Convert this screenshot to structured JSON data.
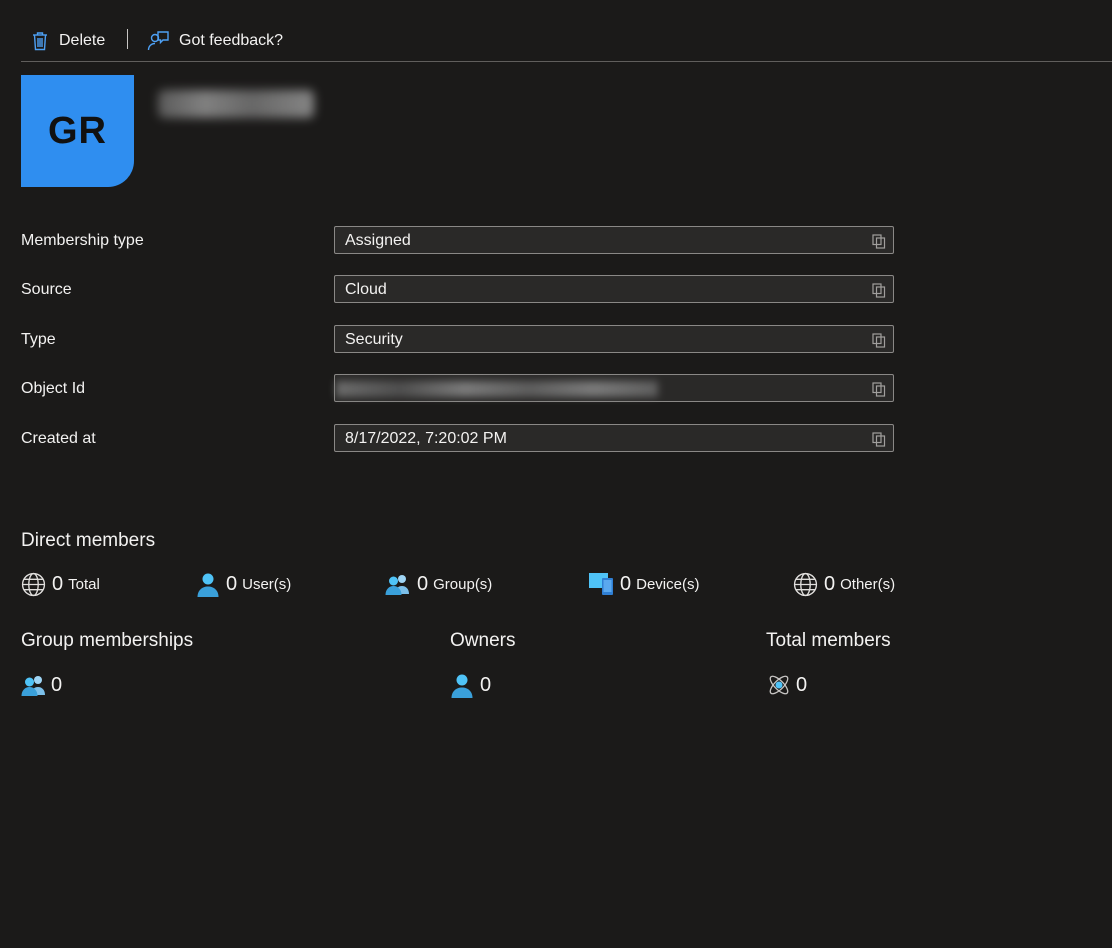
{
  "toolbar": {
    "delete_label": "Delete",
    "feedback_label": "Got feedback?"
  },
  "group": {
    "initials": "GR"
  },
  "properties": [
    {
      "label": "Membership type",
      "value": "Assigned"
    },
    {
      "label": "Source",
      "value": "Cloud"
    },
    {
      "label": "Type",
      "value": "Security"
    },
    {
      "label": "Object Id",
      "value": ""
    },
    {
      "label": "Created at",
      "value": "8/17/2022, 7:20:02 PM"
    }
  ],
  "direct_members": {
    "title": "Direct members",
    "total": {
      "count": "0",
      "label": "Total",
      "icon": "globe-icon"
    },
    "users": {
      "count": "0",
      "label": "User(s)",
      "icon": "user-icon"
    },
    "groups": {
      "count": "0",
      "label": "Group(s)",
      "icon": "group-icon"
    },
    "devices": {
      "count": "0",
      "label": "Device(s)",
      "icon": "device-icon"
    },
    "others": {
      "count": "0",
      "label": "Other(s)",
      "icon": "globe-icon"
    }
  },
  "group_memberships": {
    "title": "Group memberships",
    "count": "0"
  },
  "owners": {
    "title": "Owners",
    "count": "0"
  },
  "total_members": {
    "title": "Total members",
    "count": "0"
  },
  "colors": {
    "accent": "#2f8ef0",
    "background": "#1b1a19",
    "icon_blue": "#4fc3f7"
  }
}
